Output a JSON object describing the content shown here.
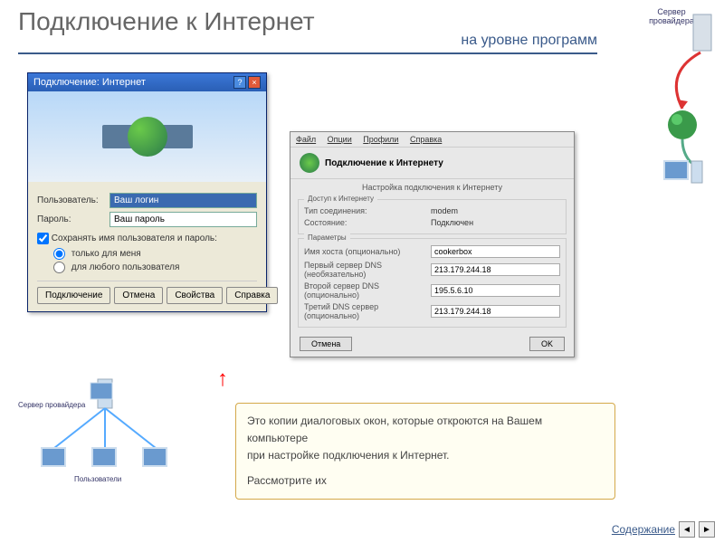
{
  "header": {
    "title": "Подключение к Интернет",
    "subtitle": "на уровне программ"
  },
  "provider_top_label": "Сервер провайдера",
  "win1": {
    "title": "Подключение: Интернет",
    "user_label": "Пользователь:",
    "user_value": "Ваш логин",
    "pass_label": "Пароль:",
    "pass_value": "Ваш пароль",
    "save_check": "Сохранять имя пользователя и пароль:",
    "radio1": "только для меня",
    "radio2": "для любого пользователя",
    "btn_connect": "Подключение",
    "btn_cancel": "Отмена",
    "btn_props": "Свойства",
    "btn_help": "Справка"
  },
  "win2": {
    "menu": {
      "file": "Файл",
      "options": "Опции",
      "profiles": "Профили",
      "help": "Справка"
    },
    "head_title": "Подключение к Интернету",
    "sub": "Настройка подключения к Интернету",
    "sec1_title": "Доступ к Интернету",
    "type_label": "Тип соединения:",
    "type_value": "modem",
    "state_label": "Состояние:",
    "state_value": "Подключен",
    "sec2_title": "Параметры",
    "host_label": "Имя хоста (опционально)",
    "host_value": "cookerbox",
    "dns1_label": "Первый сервер DNS (необязательно)",
    "dns1_value": "213.179.244.18",
    "dns2_label": "Второй сервер DNS (опционально)",
    "dns2_value": "195.5.6.10",
    "dns3_label": "Третий DNS сервер (опционально)",
    "dns3_value": "213.179.244.18",
    "btn_cancel": "Отмена",
    "btn_ok": "OK"
  },
  "illust": {
    "server_label": "Сервер провайдера",
    "users_label": "Пользователи"
  },
  "explain": {
    "line1": "Это копии диалоговых окон, которые откроются на Вашем компьютере",
    "line2": "при настройке подключения к Интернет.",
    "line3": "Рассмотрите их"
  },
  "footer": {
    "contents": "Содержание"
  }
}
